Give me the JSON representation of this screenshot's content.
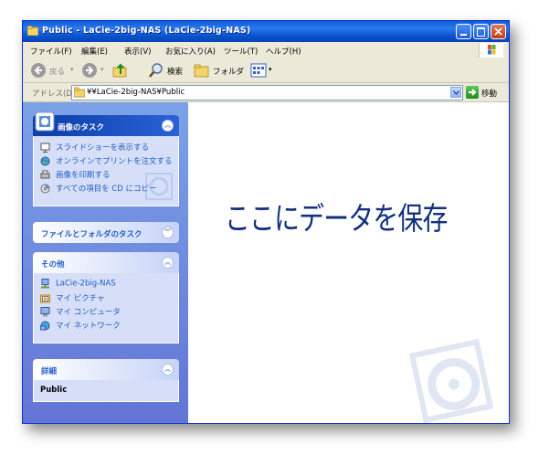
{
  "window": {
    "title": "Public - LaCie-2big-NAS (LaCie-2big-NAS)"
  },
  "menu": {
    "items": [
      "ファイル(F)",
      "編集(E)",
      "表示(V)",
      "お気に入り(A)",
      "ツール(T)",
      "ヘルプ(H)"
    ]
  },
  "toolbar": {
    "back_label": "戻る",
    "search_label": "検索",
    "folders_label": "フォルダ"
  },
  "address": {
    "label": "アドレス(D)",
    "value": "¥¥LaCie-2big-NAS¥Public",
    "go_label": "移動"
  },
  "sidebar": {
    "image_tasks": {
      "title": "画像のタスク",
      "items": [
        "スライドショーを表示する",
        "オンラインでプリントを注文する",
        "画像を印刷する",
        "すべての項目を CD にコピー"
      ]
    },
    "file_tasks": {
      "title": "ファイルとフォルダのタスク"
    },
    "other": {
      "title": "その他",
      "items": [
        "LaCie-2big-NAS",
        "マイ ピクチャ",
        "マイ コンピュータ",
        "マイ ネットワーク"
      ]
    },
    "details": {
      "title": "詳細",
      "name": "Public"
    }
  },
  "content": {
    "overlay_text": "ここにデータを保存"
  },
  "colors": {
    "title_bar": "#0a54cf",
    "sidebar": "#7ba2e7",
    "overlay_text": "#12307f"
  }
}
